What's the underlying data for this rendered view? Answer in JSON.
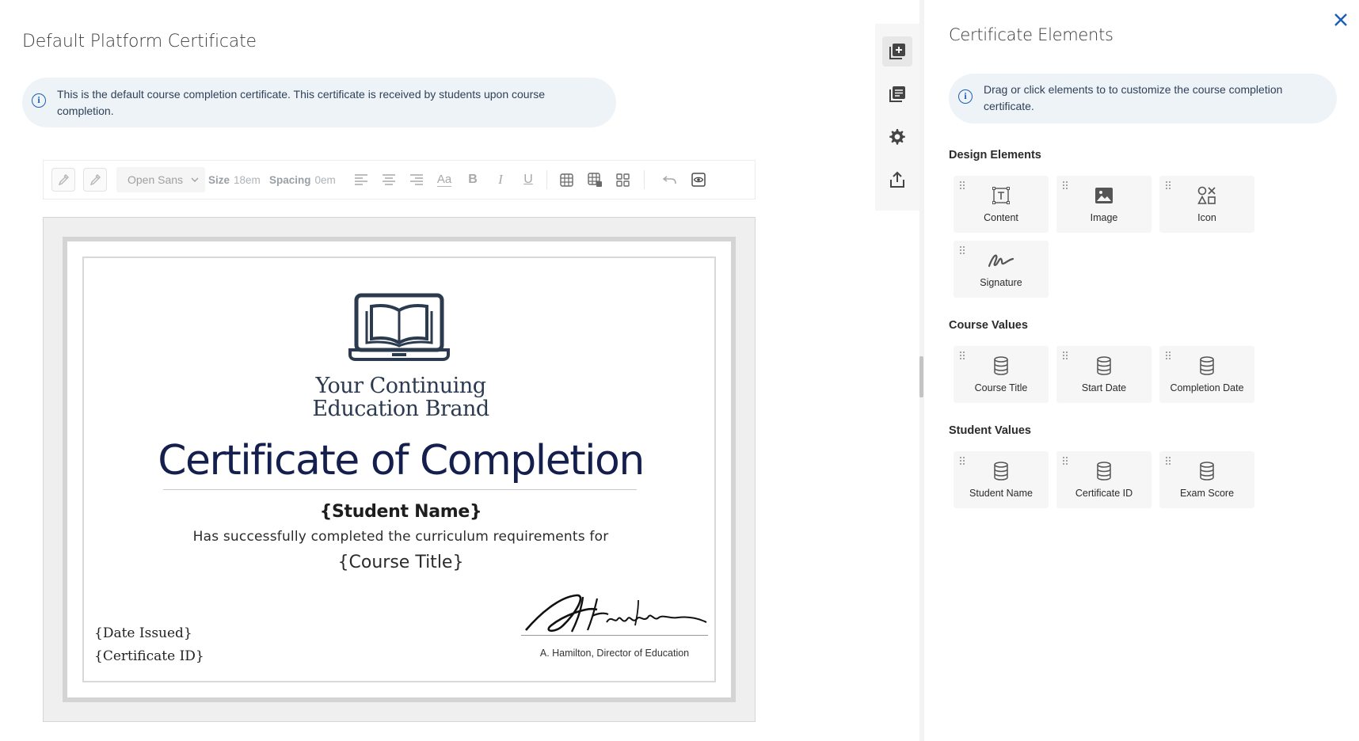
{
  "page": {
    "title": "Default Platform Certificate",
    "info": "This is the default course completion certificate. This certificate is received by students upon course completion."
  },
  "toolbar": {
    "font": "Open Sans",
    "size_label": "Size",
    "size_value": "18em",
    "spacing_label": "Spacing",
    "spacing_value": "0em",
    "text_case": "Aa",
    "bold": "B",
    "italic": "I",
    "underline": "U"
  },
  "certificate": {
    "brand_line1": "Your Continuing",
    "brand_line2": "Education Brand",
    "title": "Certificate of Completion",
    "student_name": "{Student Name}",
    "body_text": "Has successfully completed the curriculum requirements for",
    "course_title": "{Course Title}",
    "date_issued": "{Date Issued}",
    "certificate_id": "{Certificate ID}",
    "signature_caption": "A. Hamilton, Director of Education"
  },
  "panel": {
    "title": "Certificate Elements",
    "info": "Drag or click elements to to customize the course completion certificate.",
    "sections": {
      "design": {
        "heading": "Design Elements",
        "items": [
          "Content",
          "Image",
          "Icon",
          "Signature"
        ]
      },
      "course": {
        "heading": "Course Values",
        "items": [
          "Course Title",
          "Start Date",
          "Completion Date"
        ]
      },
      "student": {
        "heading": "Student Values",
        "items": [
          "Student Name",
          "Certificate ID",
          "Exam Score"
        ]
      }
    }
  },
  "colors": {
    "accent": "#1a5fb4",
    "title_navy": "#141f4e",
    "info_bg": "#eef3f8"
  },
  "icons": {
    "rail": [
      "add-page-icon",
      "templates-icon",
      "settings-gear-icon",
      "export-icon"
    ],
    "close": "close-icon"
  }
}
